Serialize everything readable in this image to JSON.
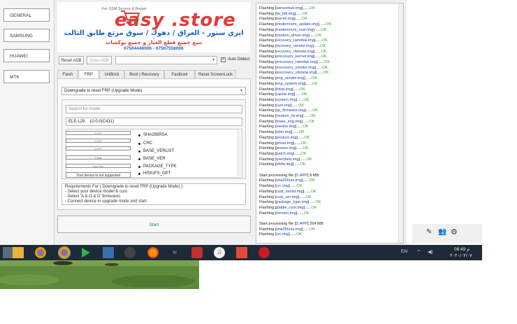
{
  "nav": {
    "items": [
      "GENERAL",
      "SAMSUNG",
      "HUAWEI",
      "MTK"
    ]
  },
  "banner": {
    "tagline": "For GSM Service & Repair",
    "brand": "easy .store",
    "arabic_line1": "ايزي ستور - العراق / دهوك / سوق مرتع طابق الثالث",
    "arabic_line2": "تبيع جميع قطع الغيار و جميع بوكسات",
    "phones": "07504446006 - 07507556006"
  },
  "toolbar": {
    "reset_adb": "Reset ADB",
    "scan_adb": "Scan ADB",
    "auto_detect": "Auto Detect"
  },
  "tabs": [
    "Flash",
    "FRP",
    "UnBrick",
    "Boot | Recovery",
    "Fastboot",
    "Reset ScreenLock"
  ],
  "frp": {
    "mode": "Downgrade to reset FRP (Upgrade Mode)",
    "search_placeholder": "Search for model",
    "model": "ELE-L29",
    "version": "10.0.0(C431)",
    "list_buttons": [
      "D.APP",
      "S.APP",
      "U.APP",
      "C Note",
      "Cust Files",
      "Your device is not supported"
    ],
    "list_items": [
      "SHA256RSA",
      "CRC",
      "BASE_VERLIST",
      "BASE_VER",
      "PACKAGE_TYPE",
      "HISIUFS_GPT"
    ],
    "requirements": [
      "Requirements For ( Downgrade to reset FRP (Upgrade Mode) ):",
      "- Select your device model & cust",
      "- Select 'A & O & D' firmwares",
      "- Connect device in upgrade mode and start"
    ],
    "start_label": "Start"
  },
  "log": {
    "prefix": "Flashing",
    "ok": "OK",
    "lines": [
      {
        "file": "sensorhub.img"
      },
      {
        "file": "fw_hifi.img"
      },
      {
        "file": "kernel.img"
      },
      {
        "file": "modemnvm_update.img"
      },
      {
        "file": "modemnvm_cust.img"
      },
      {
        "file": "modem_driver.img"
      },
      {
        "file": "recovery_ramdisk.img"
      },
      {
        "file": "recovery_vendor.img"
      },
      {
        "file": "recovery_vbmeta.img"
      },
      {
        "file": "erecovery_kernel.img"
      },
      {
        "file": "erecovery_ramdisk.img"
      },
      {
        "file": "erecovery_vendor.img"
      },
      {
        "file": "erecovery_vbmeta.img"
      },
      {
        "file": "eng_vendor.img"
      },
      {
        "file": "eng_system.img"
      },
      {
        "file": "hdcp.img"
      },
      {
        "file": "cache.img"
      },
      {
        "file": "system.img"
      },
      {
        "file": "cust.img"
      },
      {
        "file": "sp_firmware.img"
      },
      {
        "file": "modem_fw.img"
      },
      {
        "file": "hisee_img.img"
      },
      {
        "file": "vendor.img"
      },
      {
        "file": "odm.img"
      },
      {
        "file": "product.img"
      },
      {
        "file": "preas.img"
      },
      {
        "file": "preavs.img"
      },
      {
        "file": "patch.img"
      },
      {
        "file": "userdata.img"
      },
      {
        "file": "ufsfw.img"
      }
    ],
    "section2_title": "Start processing file",
    "section2_file": "D.APP",
    "section2_size": "9 MB",
    "section2_lines": [
      {
        "file": "sha256rsa.img"
      },
      {
        "file": "crc.img"
      },
      {
        "file": "cust_verlist.img"
      },
      {
        "file": "cust_ver.img"
      },
      {
        "file": "package_type.img"
      },
      {
        "file": "ptable_cust.img"
      },
      {
        "file": "version.img"
      }
    ],
    "section3_file": "D.APP",
    "section3_size": "254 MB",
    "section3_lines": [
      {
        "file": "sha256rsa.img"
      },
      {
        "file": "crc.img"
      }
    ]
  },
  "taskbar": {
    "language": "EN",
    "time": "08:49 م",
    "date": "٢٠٢٠/٠٢/٠٧"
  },
  "colors": {
    "ok_green": "#2ea52e",
    "log_blue": "#1f3fa8",
    "brand_red": "#e23a3a",
    "taskbar": "#1f2a38"
  }
}
